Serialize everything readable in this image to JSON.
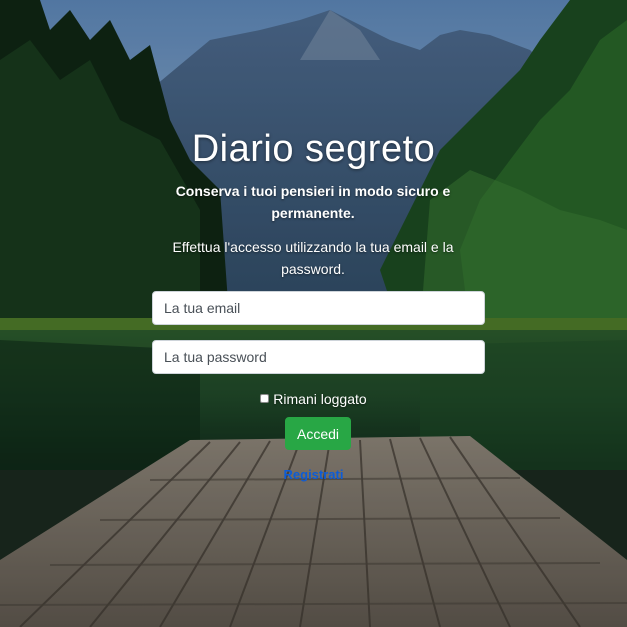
{
  "page": {
    "title": "Diario segreto",
    "subtitle": "Conserva i tuoi pensieri in modo sicuro e permanente.",
    "instructions": "Effettua l'accesso utilizzando la tua email e la password."
  },
  "form": {
    "email_placeholder": "La tua email",
    "password_placeholder": "La tua password",
    "remember_label": "Rimani loggato",
    "remember_checked": false,
    "submit_label": "Accedi",
    "register_link": "Registrati"
  },
  "colors": {
    "submit_button": "#28a745",
    "register_link": "#0d5cd6",
    "text": "#ffffff"
  }
}
